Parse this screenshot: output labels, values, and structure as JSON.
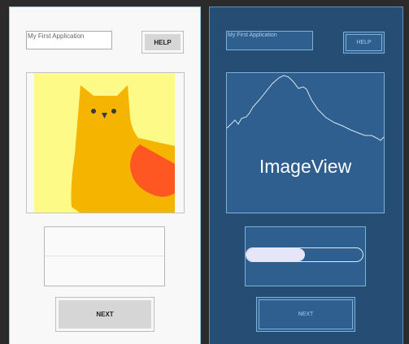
{
  "design_view": {
    "title_text": "My First Application",
    "help_label": "HELP",
    "next_label": "NEXT"
  },
  "blueprint_view": {
    "title_text": "My First Application",
    "help_label": "HELP",
    "image_label": "ImageView",
    "next_label": "NEXT",
    "progress_value": 0.5
  },
  "colors": {
    "design_background": "#f8f8f8",
    "blueprint_background": "#264d73",
    "blueprint_widget": "#2f5f8e",
    "blueprint_outline": "#7fb0d8",
    "image_background": "#fdfa87",
    "cat_body": "#f5b400",
    "cat_accent": "#ff5722"
  },
  "icons": {
    "image_preview": "cat-illustration",
    "blueprint_preview": "mountain-outline"
  }
}
